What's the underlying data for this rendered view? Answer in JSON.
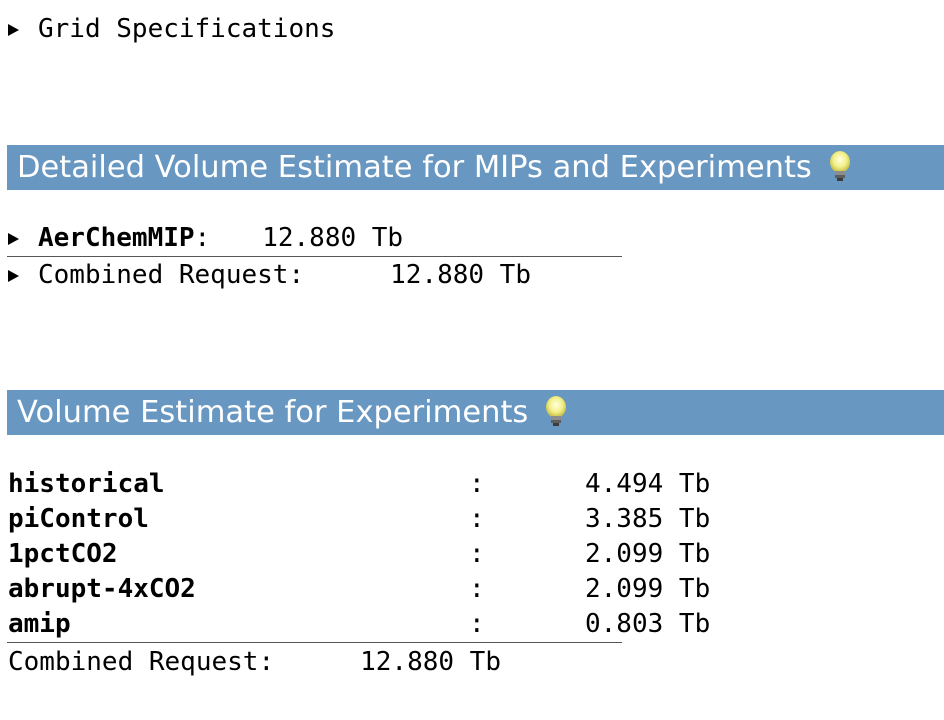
{
  "grid_spec": {
    "label": "Grid Specifications"
  },
  "detailed": {
    "title": "Detailed Volume Estimate for MIPs and Experiments",
    "mip_name": "AerChemMIP",
    "mip_sep": ":",
    "mip_value": "12.880 Tb",
    "combined_label": "Combined Request:",
    "combined_value": "12.880 Tb"
  },
  "experiments": {
    "title": "Volume Estimate for Experiments",
    "rows": [
      {
        "name": "historical",
        "sep": ":",
        "value": "4.494 Tb"
      },
      {
        "name": "piControl",
        "sep": ":",
        "value": "3.385 Tb"
      },
      {
        "name": "1pctCO2",
        "sep": ":",
        "value": "2.099 Tb"
      },
      {
        "name": "abrupt-4xCO2",
        "sep": ":",
        "value": "2.099 Tb"
      },
      {
        "name": "amip",
        "sep": ":",
        "value": "0.803 Tb"
      }
    ],
    "combined_label": "Combined Request:",
    "combined_value": "12.880 Tb"
  },
  "icons": {
    "section_hint": "lightbulb-icon",
    "expand": "triangle-right-icon"
  },
  "colors": {
    "header_bar": "#6897c2",
    "header_text": "#ffffff"
  }
}
